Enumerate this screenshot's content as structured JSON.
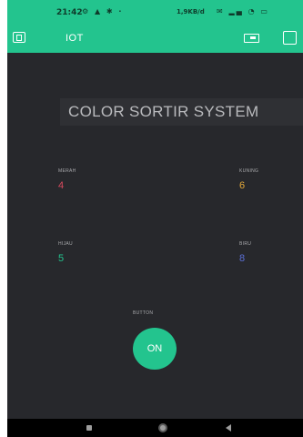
{
  "status_bar": {
    "time": "21:42",
    "left_icons": "⚙ ▲ ✱ ·",
    "network": "1,9KB/d",
    "right_icons": "✉ ▂▄ ◔ ▭"
  },
  "app_bar": {
    "title": "IOT"
  },
  "title_label": "COLOR SORTIR SYSTEM",
  "widgets": {
    "merah": {
      "label": "MERAH",
      "value": "4",
      "color": "#d94a5e"
    },
    "kuning": {
      "label": "KUNING",
      "value": "6",
      "color": "#e4a93a"
    },
    "hijau": {
      "label": "HIJAU",
      "value": "5",
      "color": "#23c48e"
    },
    "biru": {
      "label": "BIRU",
      "value": "8",
      "color": "#5b6fd6"
    }
  },
  "button_widget": {
    "label": "BUTTON",
    "state_label": "ON",
    "color": "#23c48e"
  },
  "icons": {
    "app_left": "device-icon",
    "switch": "switch-icon",
    "square": "square-icon",
    "nav_recent": "recent-apps-icon",
    "nav_home": "home-icon",
    "nav_back": "back-icon"
  }
}
